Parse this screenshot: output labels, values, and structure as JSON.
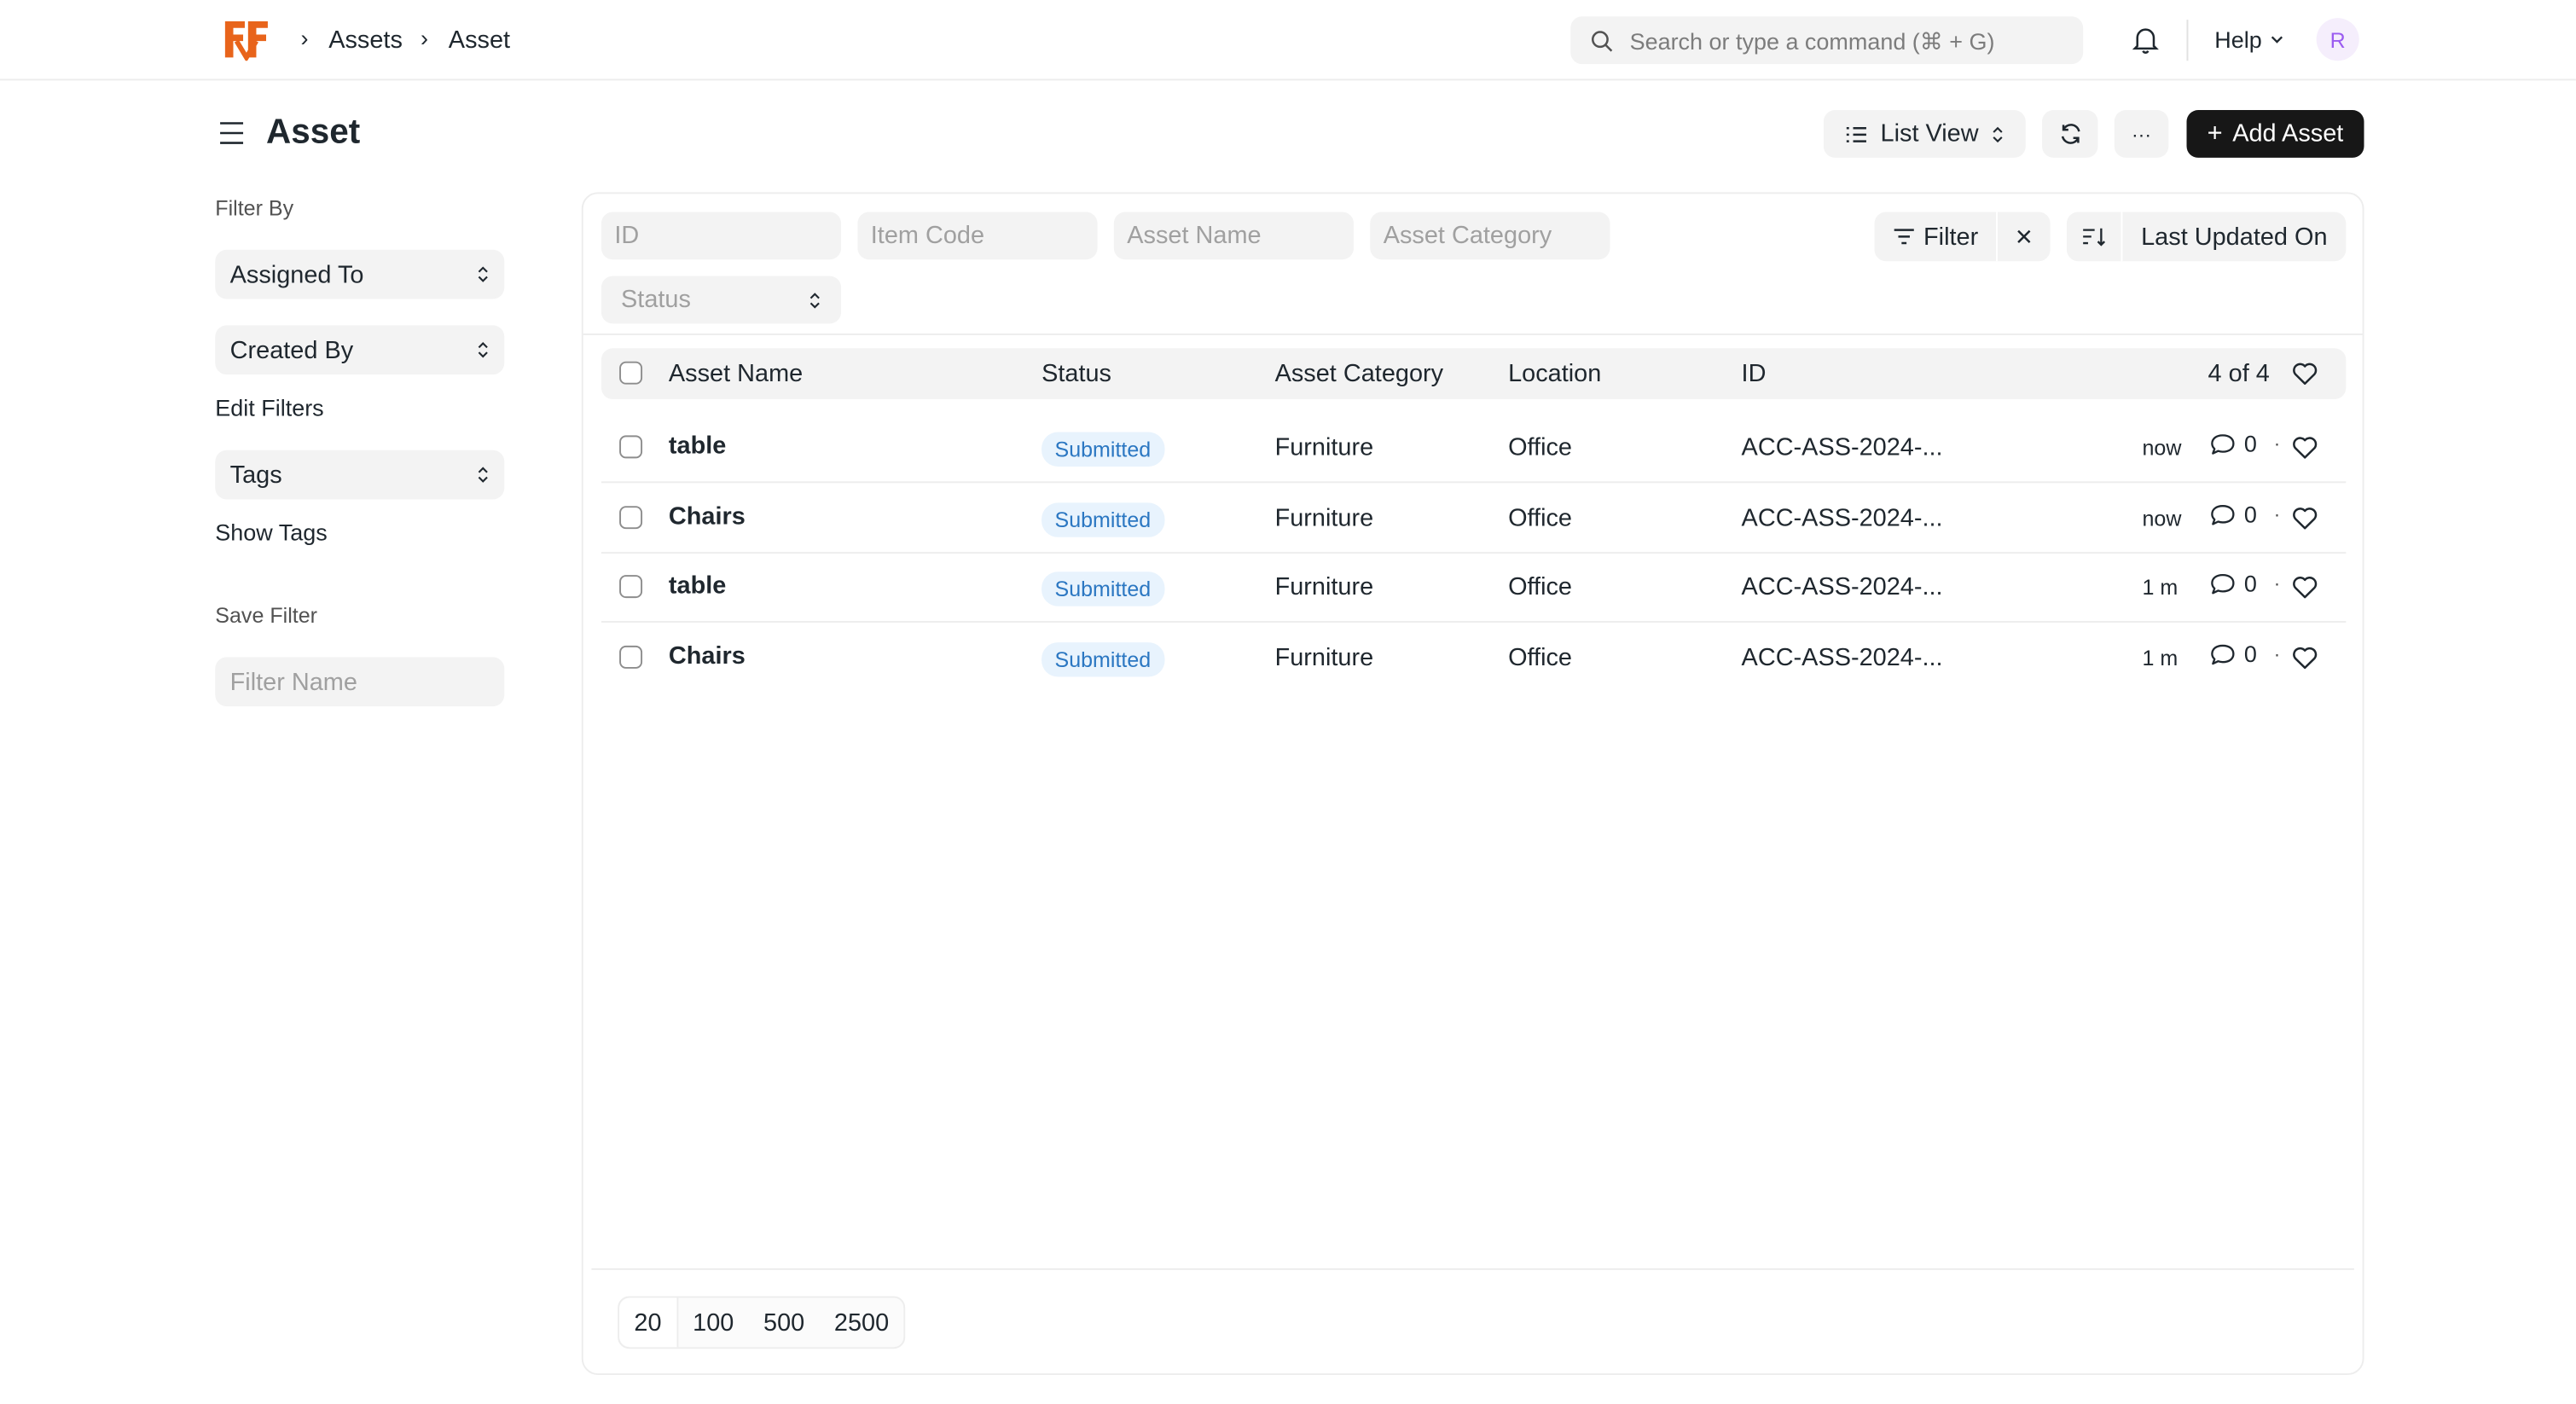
{
  "navbar": {
    "breadcrumbs": [
      "Assets",
      "Asset"
    ],
    "search_placeholder": "Search or type a command (⌘ + G)",
    "help_label": "Help",
    "avatar_initial": "R",
    "logo_color": "#e8641b"
  },
  "page": {
    "title": "Asset",
    "view_label": "List View",
    "more_label": "···",
    "add_label": "Add Asset"
  },
  "sidebar": {
    "filter_by_label": "Filter By",
    "assigned_to": "Assigned To",
    "created_by": "Created By",
    "edit_filters": "Edit Filters",
    "tags": "Tags",
    "show_tags": "Show Tags",
    "save_filter_label": "Save Filter",
    "filter_name_placeholder": "Filter Name"
  },
  "filters": {
    "id_placeholder": "ID",
    "item_code_placeholder": "Item Code",
    "asset_name_placeholder": "Asset Name",
    "asset_category_placeholder": "Asset Category",
    "status_placeholder": "Status",
    "filter_label": "Filter",
    "sort_label": "Last Updated On"
  },
  "table": {
    "columns": {
      "asset_name": "Asset Name",
      "status": "Status",
      "asset_category": "Asset Category",
      "location": "Location",
      "id": "ID"
    },
    "count": "4 of 4",
    "rows": [
      {
        "name": "table",
        "status": "Submitted",
        "category": "Furniture",
        "location": "Office",
        "id": "ACC-ASS-2024-...",
        "time": "now",
        "comments": "0"
      },
      {
        "name": "Chairs",
        "status": "Submitted",
        "category": "Furniture",
        "location": "Office",
        "id": "ACC-ASS-2024-...",
        "time": "now",
        "comments": "0"
      },
      {
        "name": "table",
        "status": "Submitted",
        "category": "Furniture",
        "location": "Office",
        "id": "ACC-ASS-2024-...",
        "time": "1 m",
        "comments": "0"
      },
      {
        "name": "Chairs",
        "status": "Submitted",
        "category": "Furniture",
        "location": "Office",
        "id": "ACC-ASS-2024-...",
        "time": "1 m",
        "comments": "0"
      }
    ]
  },
  "pager": {
    "sizes": [
      "20",
      "100",
      "500",
      "2500"
    ],
    "selected": "20"
  },
  "colors": {
    "accent": "#171717",
    "badge_bg": "#e8f3fd",
    "badge_text": "#2b77c2"
  }
}
